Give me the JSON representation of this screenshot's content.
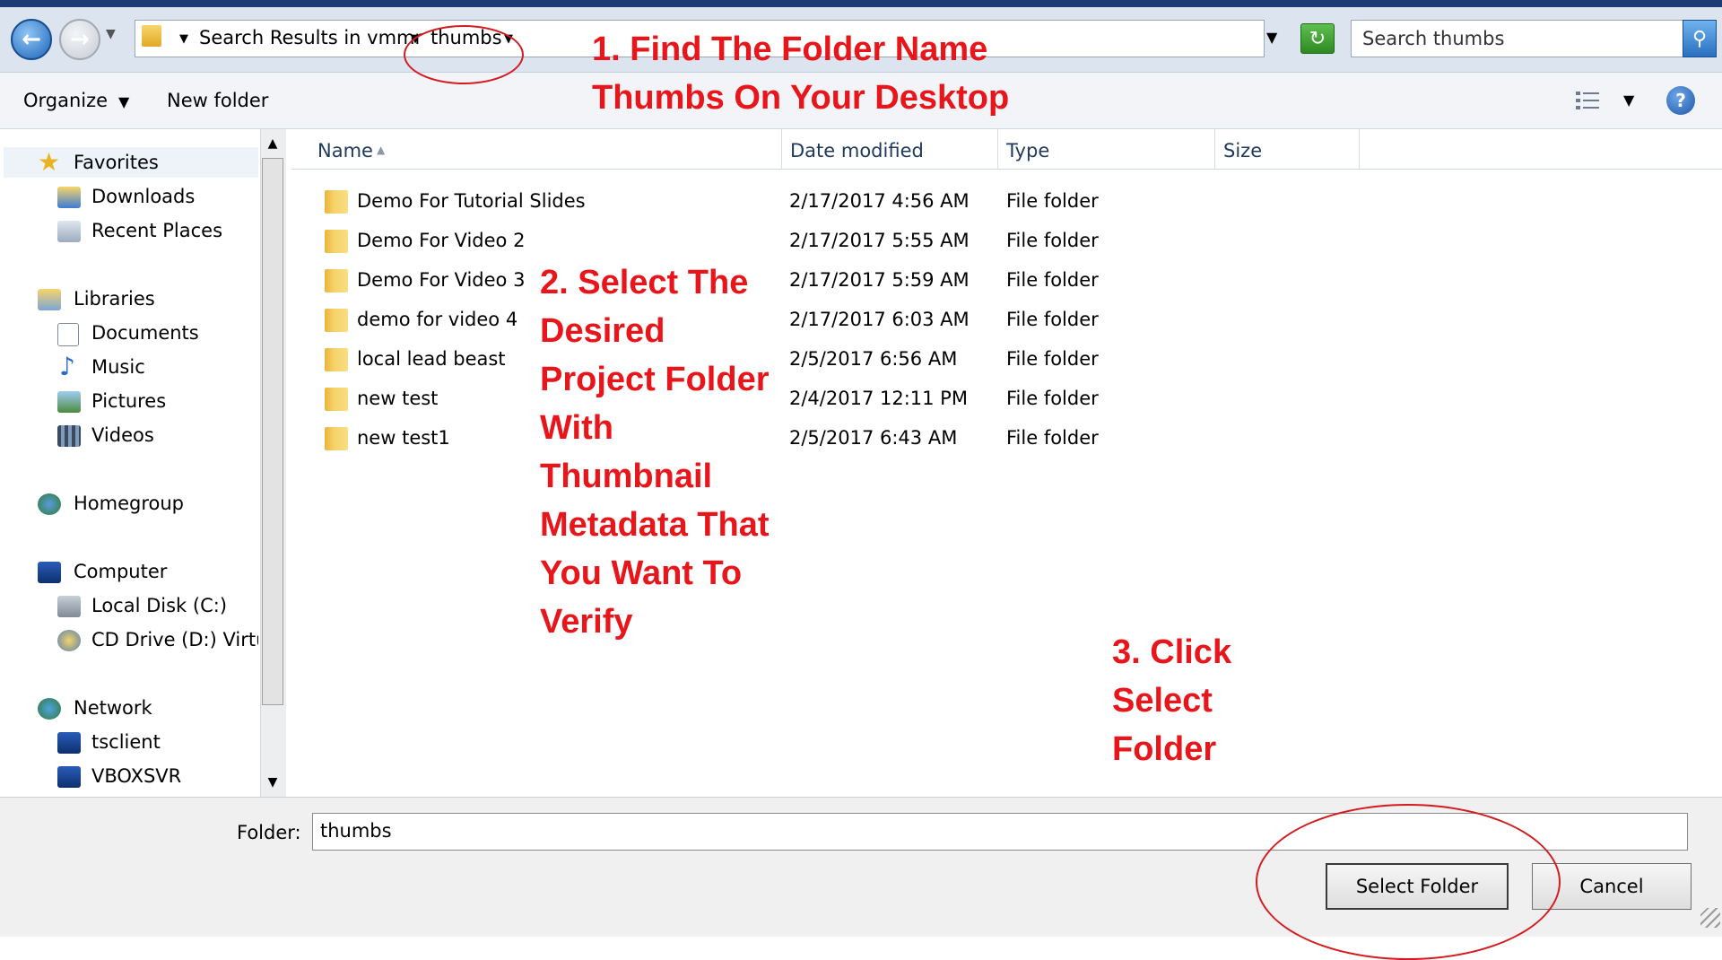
{
  "address_bar": {
    "breadcrumbs": [
      "Search Results in vmmr",
      "thumbs"
    ],
    "search_placeholder": "Search thumbs"
  },
  "toolbar": {
    "organize": "Organize",
    "new_folder": "New folder"
  },
  "nav_pane": {
    "favorites": "Favorites",
    "downloads": "Downloads",
    "recent_places": "Recent Places",
    "libraries": "Libraries",
    "documents": "Documents",
    "music": "Music",
    "pictures": "Pictures",
    "videos": "Videos",
    "homegroup": "Homegroup",
    "computer": "Computer",
    "local_disk": "Local Disk (C:)",
    "cd_drive": "CD Drive (D:) Virtu",
    "network": "Network",
    "tsclient": "tsclient",
    "vboxsvr": "VBOXSVR"
  },
  "file_list": {
    "columns": [
      "Name",
      "Date modified",
      "Type",
      "Size"
    ],
    "rows": [
      {
        "name": "Demo For Tutorial Slides",
        "date": "2/17/2017 4:56 AM",
        "type": "File folder"
      },
      {
        "name": "Demo For Video 2",
        "date": "2/17/2017 5:55 AM",
        "type": "File folder"
      },
      {
        "name": "Demo For Video 3",
        "date": "2/17/2017 5:59 AM",
        "type": "File folder"
      },
      {
        "name": "demo for video 4",
        "date": "2/17/2017 6:03 AM",
        "type": "File folder"
      },
      {
        "name": "local lead beast",
        "date": "2/5/2017 6:56 AM",
        "type": "File folder"
      },
      {
        "name": "new test",
        "date": "2/4/2017 12:11 PM",
        "type": "File folder"
      },
      {
        "name": "new test1",
        "date": "2/5/2017 6:43 AM",
        "type": "File folder"
      }
    ]
  },
  "bottom": {
    "folder_label": "Folder:",
    "folder_value": "thumbs",
    "select_button": "Select Folder",
    "cancel_button": "Cancel"
  },
  "annotations": {
    "step1": [
      "1. Find The Folder Name",
      "Thumbs On Your Desktop"
    ],
    "step2": [
      "2. Select The",
      "Desired",
      "Project Folder",
      "With",
      "Thumbnail",
      "Metadata That",
      "You Want To",
      "Verify"
    ],
    "step3": [
      "3. Click",
      "Select",
      "Folder"
    ]
  },
  "colors": {
    "annotation_red": "#e8161b",
    "folder_yellow": "#f6d36a"
  }
}
